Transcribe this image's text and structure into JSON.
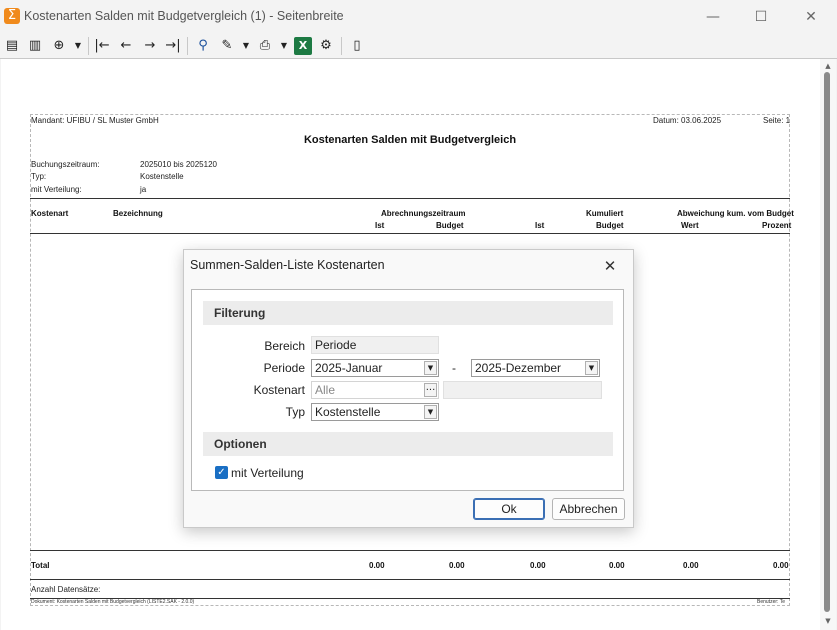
{
  "window": {
    "title": "Kostenarten Salden mit Budgetvergleich (1) - Seitenbreite",
    "app_icon": "sigma-icon",
    "controls": {
      "minimize": "—",
      "maximize": "☐",
      "close": "✕"
    }
  },
  "toolbar": {
    "icons": [
      "page-icon",
      "page-width-icon",
      "zoom-icon",
      "first-page-icon",
      "previous-page-icon",
      "next-page-icon",
      "last-page-icon",
      "search-icon",
      "edit-icon",
      "print-icon",
      "excel-icon",
      "settings-icon",
      "exit-icon"
    ],
    "glyphs": {
      "page": "▤",
      "page_width": "▥",
      "zoom": "⊕",
      "dropdown": "▼",
      "first": "|←",
      "prev": "←",
      "next": "→",
      "last": "→|",
      "search": "⚲",
      "edit": "✎",
      "print": "⎙",
      "excel": "X",
      "settings": "⚙",
      "exit": "▯"
    }
  },
  "report": {
    "mandant": "Mandant: UFIBU / SL Muster GmbH",
    "datum": "Datum:  03.06.2025",
    "seite": "Seite: 1",
    "title": "Kostenarten Salden mit Budgetvergleich",
    "params": [
      {
        "label": "Buchungszeitraum:",
        "value": "2025010 bis 2025120"
      },
      {
        "label": "Typ:",
        "value": "Kostenstelle"
      },
      {
        "label": "mit Verteilung:",
        "value": "ja"
      }
    ],
    "columns": {
      "kostenart": "Kostenart",
      "bezeichnung": "Bezeichnung",
      "abrechnungszeitraum": "Abrechnungszeitraum",
      "kumuliert": "Kumuliert",
      "abweichung": "Abweichung kum. vom Budget",
      "ist1": "Ist",
      "budget1": "Budget",
      "ist2": "Ist",
      "budget2": "Budget",
      "wert": "Wert",
      "prozent": "Prozent"
    },
    "total": {
      "label": "Total",
      "values": [
        "0.00",
        "0.00",
        "0.00",
        "0.00",
        "0.00",
        "0.00"
      ]
    },
    "anzahl": "Anzahl Datensätze:",
    "footer_left": "Dokument:  Kostenarten Salden mit Budgetvergleich (LISTE2.SAK - 2.0.0)",
    "footer_right": "Benutzer: Te"
  },
  "dialog": {
    "title": "Summen-Salden-Liste Kostenarten",
    "close_glyph": "✕",
    "filter_header": "Filterung",
    "bereich_label": "Bereich",
    "bereich_value": "Periode",
    "periode_label": "Periode",
    "periode_from": "2025-Januar",
    "periode_sep": "-",
    "periode_to": "2025-Dezember",
    "kostenart_label": "Kostenart",
    "kostenart_placeholder": "Alle",
    "kostenart_browse": "...",
    "typ_label": "Typ",
    "typ_value": "Kostenstelle",
    "options_header": "Optionen",
    "verteilung_label": "mit Verteilung",
    "verteilung_checked": true,
    "ok_label": "Ok",
    "cancel_label": "Abbrechen",
    "dropdown_glyph": "▼",
    "check_glyph": "✓"
  }
}
